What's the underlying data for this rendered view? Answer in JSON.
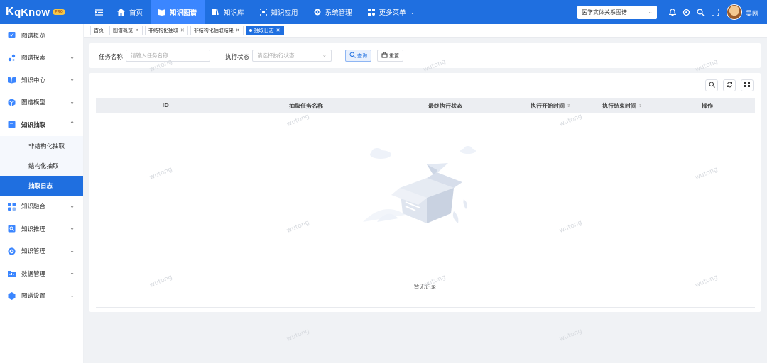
{
  "app": {
    "logo_mark": "K",
    "logo_text": "qKnow",
    "badge": "PRO"
  },
  "topnav": [
    {
      "label": "首页",
      "icon": "home-icon",
      "active": false
    },
    {
      "label": "知识图谱",
      "icon": "graph-book-icon",
      "active": true
    },
    {
      "label": "知识库",
      "icon": "library-icon",
      "active": false
    },
    {
      "label": "知识应用",
      "icon": "app-icon",
      "active": false
    },
    {
      "label": "系统管理",
      "icon": "settings-icon",
      "active": false
    },
    {
      "label": "更多菜单",
      "icon": "grid-icon",
      "active": false
    }
  ],
  "graph_selector": {
    "value": "医学实体关系图谱"
  },
  "user": {
    "name": "吴网"
  },
  "sidebar": {
    "items": [
      {
        "label": "图谱概览",
        "icon": "overview-icon"
      },
      {
        "label": "图谱探索",
        "icon": "explore-icon"
      },
      {
        "label": "知识中心",
        "icon": "book-icon"
      },
      {
        "label": "图谱模型",
        "icon": "model-icon"
      },
      {
        "label": "知识抽取",
        "icon": "extract-icon"
      },
      {
        "label": "知识融合",
        "icon": "fusion-icon"
      },
      {
        "label": "知识推理",
        "icon": "reasoning-icon"
      },
      {
        "label": "知识管理",
        "icon": "manage-icon"
      },
      {
        "label": "数据管理",
        "icon": "data-icon"
      },
      {
        "label": "图谱设置",
        "icon": "settings-cube-icon"
      }
    ],
    "sub_items": [
      {
        "label": "非结构化抽取"
      },
      {
        "label": "结构化抽取"
      },
      {
        "label": "抽取日志"
      }
    ]
  },
  "tabs": [
    {
      "label": "首页",
      "closable": false
    },
    {
      "label": "图谱概览",
      "closable": true
    },
    {
      "label": "非结构化抽取",
      "closable": true
    },
    {
      "label": "非结构化抽取结果",
      "closable": true
    },
    {
      "label": "抽取日志",
      "closable": true,
      "active": true
    }
  ],
  "search": {
    "task_name_label": "任务名称",
    "task_name_placeholder": "请输入任务名称",
    "status_label": "执行状态",
    "status_placeholder": "请选择执行状态",
    "query_label": "查询",
    "reset_label": "重置"
  },
  "table": {
    "columns": [
      "ID",
      "抽取任务名称",
      "最终执行状态",
      "执行开始时间",
      "执行结束时间",
      "操作"
    ],
    "rows": [],
    "empty_text": "暂无记录"
  },
  "watermark": "wutong",
  "colors": {
    "primary": "#1f6fe0",
    "active_nav": "#3b86ff",
    "background": "#f0f2f5"
  }
}
